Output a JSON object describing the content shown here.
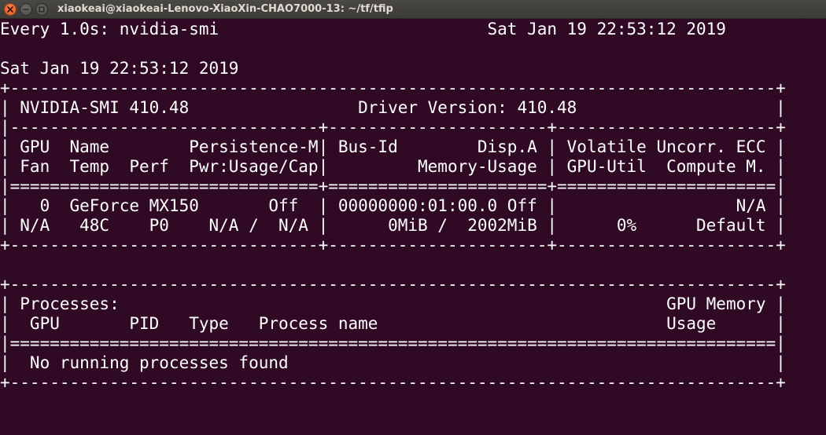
{
  "window": {
    "title": "xiaokeai@xiaokeai-Lenovo-XiaoXin-CHAO7000-13: ~/tf/tfip",
    "buttons": [
      "close",
      "minimize",
      "maximize"
    ]
  },
  "terminal": {
    "lines": [
      "Every 1.0s: nvidia-smi                           Sat Jan 19 22:53:12 2019",
      "",
      "Sat Jan 19 22:53:12 2019",
      "+-----------------------------------------------------------------------------+",
      "| NVIDIA-SMI 410.48                 Driver Version: 410.48                    |",
      "|-------------------------------+----------------------+----------------------+",
      "| GPU  Name        Persistence-M| Bus-Id        Disp.A | Volatile Uncorr. ECC |",
      "| Fan  Temp  Perf  Pwr:Usage/Cap|         Memory-Usage | GPU-Util  Compute M. |",
      "|===============================+======================+======================|",
      "|   0  GeForce MX150       Off  | 00000000:01:00.0 Off |                  N/A |",
      "| N/A   48C    P0    N/A /  N/A |      0MiB /  2002MiB |      0%      Default |",
      "+-------------------------------+----------------------+----------------------+",
      "",
      "+-----------------------------------------------------------------------------+",
      "| Processes:                                                       GPU Memory |",
      "|  GPU       PID   Type   Process name                             Usage      |",
      "|=============================================================================|",
      "|  No running processes found                                                 |",
      "+-----------------------------------------------------------------------------+"
    ]
  }
}
